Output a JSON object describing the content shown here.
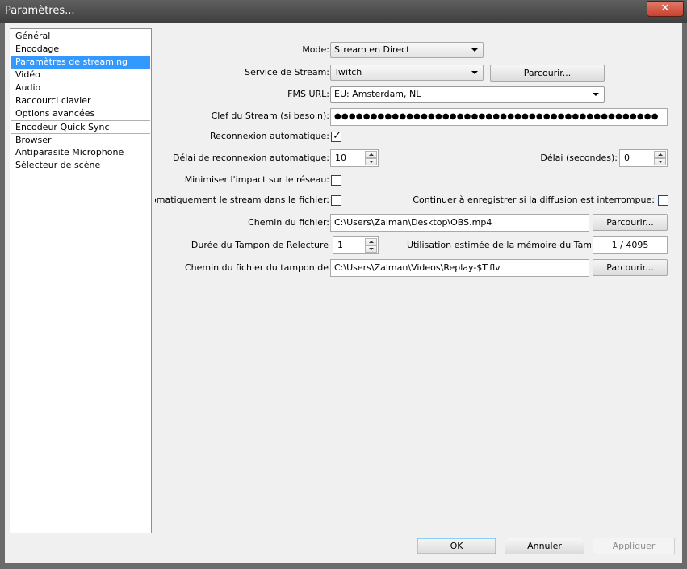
{
  "window": {
    "title": "Paramètres...",
    "close_label": "✕"
  },
  "sidebar": {
    "items": [
      {
        "label": "Général"
      },
      {
        "label": "Encodage"
      },
      {
        "label": "Paramètres de streaming"
      },
      {
        "label": "Vidéo"
      },
      {
        "label": "Audio"
      },
      {
        "label": "Raccourci clavier"
      },
      {
        "label": "Options avancées"
      },
      {
        "label": "Encodeur Quick Sync"
      },
      {
        "label": "Browser"
      },
      {
        "label": "Antiparasite Microphone"
      },
      {
        "label": "Sélecteur de scène"
      }
    ],
    "selected": "Paramètres de streaming"
  },
  "form": {
    "mode_label": "Mode:",
    "mode_value": "Stream en Direct",
    "service_label": "Service de Stream:",
    "service_value": "Twitch",
    "service_browse": "Parcourir...",
    "fms_label": "FMS URL:",
    "fms_value": "EU: Amsterdam, NL",
    "key_label": "Clef du Stream (si besoin):",
    "key_value": "●●●●●●●●●●●●●●●●●●●●●●●●●●●●●●●●●●●●●●●●●●●●●",
    "auto_reconnect_label": "Reconnexion automatique:",
    "auto_reconnect_checked": true,
    "reconnect_delay_label": "Délai de reconnexion automatique:",
    "reconnect_delay_value": "10",
    "delay_seconds_label": "Délai (secondes):",
    "delay_seconds_value": "0",
    "minimize_label": "Minimiser l'impact sur le réseau:",
    "minimize_checked": false,
    "auto_save_label": "automatiquement le stream dans le fichier:",
    "auto_save_checked": false,
    "continue_label": "Continuer à enregistrer si la diffusion est interrompue:",
    "continue_checked": false,
    "file_path_label": "Chemin du fichier:",
    "file_path_value": "C:\\Users\\Zalman\\Desktop\\OBS.mp4",
    "file_browse": "Parcourir...",
    "buffer_duration_label": "Durée du Tampon de Relecture",
    "buffer_duration_value": "1",
    "memory_label": "Utilisation estimée de la mémoire du Tampon de",
    "memory_value": "1 / 4095",
    "buffer_path_label": "Chemin du fichier du tampon de",
    "buffer_path_value": "C:\\Users\\Zalman\\Videos\\Replay-$T.flv",
    "buffer_browse": "Parcourir..."
  },
  "footer": {
    "ok": "OK",
    "cancel": "Annuler",
    "apply": "Appliquer"
  }
}
